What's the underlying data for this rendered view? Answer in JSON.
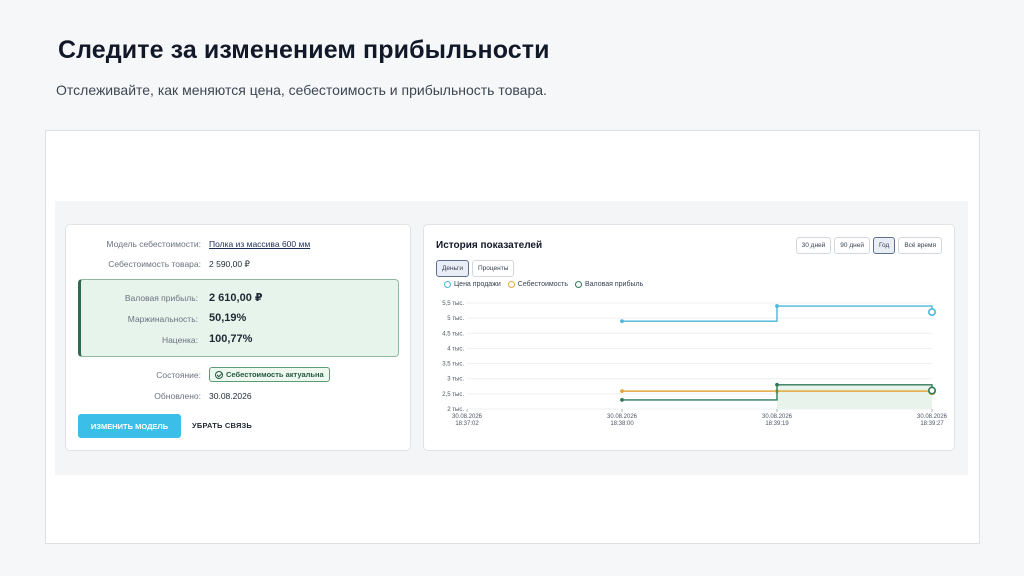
{
  "hero": {
    "title": "Следите за изменением прибыльности",
    "subtitle": "Отслеживайте, как меняются цена, себестоимость и прибыльность товара."
  },
  "details": {
    "model_label": "Модель себестоимости:",
    "model_value": "Полка из массива 600 мм",
    "cost_label": "Себестоимость товара:",
    "cost_value": "2 590,00 ₽",
    "gross_label": "Валовая прибыль:",
    "gross_value": "2 610,00 ₽",
    "margin_label": "Маржинальность:",
    "margin_value": "50,19%",
    "markup_label": "Наценка:",
    "markup_value": "100,77%",
    "status_label": "Состояние:",
    "status_badge": "Себестоимость актуальна",
    "updated_label": "Обновлено:",
    "updated_value": "30.08.2026",
    "change_model_button": "ИЗМЕНИТЬ МОДЕЛЬ",
    "unlink_button": "УБРАТЬ СВЯЗЬ"
  },
  "history": {
    "title": "История показателей",
    "ranges": [
      "30 дней",
      "90 дней",
      "Год",
      "Всё время"
    ],
    "active_range": "Год",
    "modes": [
      "Деньги",
      "Проценты"
    ],
    "active_mode": "Деньги"
  },
  "colors": {
    "price": "#4bb8d8",
    "cost": "#e3a63b",
    "profit": "#2f7a5a",
    "accent": "#3bbfe8"
  },
  "chart_data": {
    "type": "line",
    "y_tick_labels": [
      "5,5 тыс.",
      "5 тыс.",
      "4,5 тыс.",
      "4 тыс.",
      "3,5 тыс.",
      "3 тыс.",
      "2,5 тыс.",
      "2 тыс."
    ],
    "y_ticks": [
      5500,
      5000,
      4500,
      4000,
      3500,
      3000,
      2500,
      2000
    ],
    "ylim": [
      2000,
      5500
    ],
    "x_tick_labels": [
      [
        "30.08.2026",
        "18:37:02"
      ],
      [
        "30.08.2026",
        "18:38:00"
      ],
      [
        "30.08.2026",
        "18:39:19"
      ],
      [
        "30.08.2026",
        "18:39:27"
      ]
    ],
    "x": [
      0,
      1,
      2,
      3
    ],
    "step": true,
    "series": [
      {
        "name": "Цена продажи",
        "color_key": "price",
        "values": [
          null,
          4900,
          5400,
          5200
        ]
      },
      {
        "name": "Себестоимость",
        "color_key": "cost",
        "values": [
          null,
          2590,
          2590,
          2590
        ]
      },
      {
        "name": "Валовая прибыль",
        "color_key": "profit",
        "values": [
          null,
          2300,
          2800,
          2610
        ]
      }
    ],
    "grid": true,
    "legend": "top-left"
  }
}
